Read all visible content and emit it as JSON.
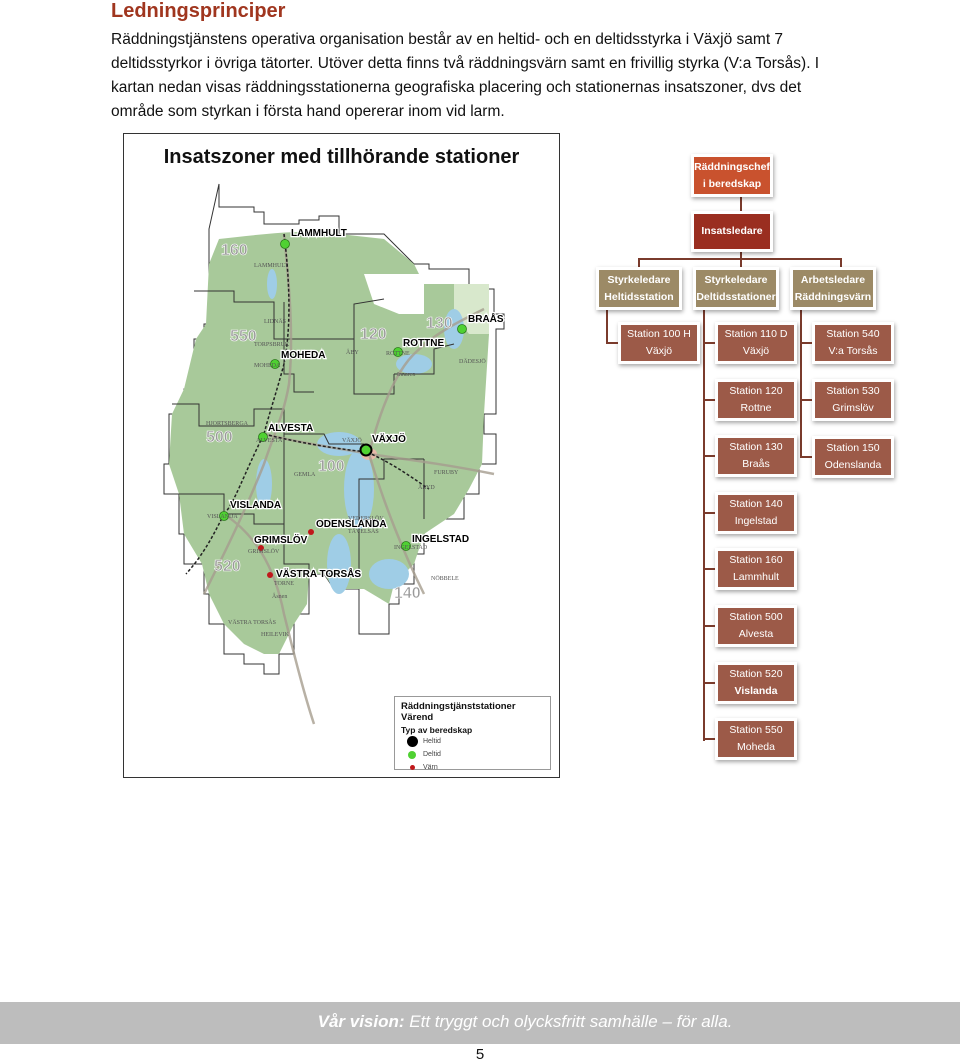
{
  "section": {
    "heading": "Ledningsprinciper",
    "paragraph": "Räddningstjänstens operativa organisation består av en heltid- och en deltidsstyrka i Växjö samt 7 deltidsstyrkor i övriga tätorter. Utöver detta finns två räddningsvärn samt en frivillig styrka (V:a Torsås). I kartan nedan visas räddningsstationerna geografiska placering och stationernas insatszoner, dvs det område som styrkan i första hand opererar inom vid larm."
  },
  "map": {
    "title": "Insatszoner med tillhörande stationer",
    "zone_numbers": [
      "160",
      "550",
      "120",
      "130",
      "500",
      "100",
      "520",
      "140"
    ],
    "station_labels": [
      "LAMMHULT",
      "BRAÅS",
      "MOHEDA",
      "ROTTNE",
      "ALVESTA",
      "VÄXJÖ",
      "VISLANDA",
      "ODENSLANDA",
      "GRIMSLÖV",
      "INGELSTAD",
      "VÄSTRA TORSÅS"
    ],
    "place_names": [
      "LAMMHULT",
      "LIDNÄS",
      "TORPSBRUK",
      "MOHEDA",
      "ÅBY",
      "ROTTNE",
      "DÄDESJÖ",
      "Innaren",
      "HJORTSBERGA",
      "ALVESTA",
      "VÄXJÖ",
      "GEMLA",
      "FURUBY",
      "ÅRYD",
      "VISLANDA",
      "VEDERSLÖV",
      "TÄVELSÅS",
      "GRIMSLÖV",
      "INGELSTAD",
      "TORNE",
      "Åsnen",
      "NÖBBELE",
      "VÄSTRA TORSÅS",
      "HEILEVIK"
    ],
    "legend": {
      "title": "Räddningstjänststationer Värend",
      "subtitle": "Typ av beredskap",
      "items": [
        {
          "label": "Heltid",
          "color": "#000000"
        },
        {
          "label": "Deltid",
          "color": "#4fd132"
        },
        {
          "label": "Värn",
          "color": "#c0181b"
        }
      ]
    }
  },
  "org_chart": {
    "chief": "Räddningschef i beredskap",
    "incident_commander": "Insatsledare",
    "leaders": [
      {
        "line1": "Styrkeledare",
        "line2": "Heltidsstation"
      },
      {
        "line1": "Styrkeledare",
        "line2": "Deltidsstationer"
      },
      {
        "line1": "Arbetsledare",
        "line2": "Räddningsvärn"
      }
    ],
    "fulltime_stations": [
      {
        "line1": "Station 100 H",
        "line2": "Växjö"
      }
    ],
    "parttime_stations": [
      {
        "line1": "Station 110 D",
        "line2": "Växjö"
      },
      {
        "line1": "Station 120",
        "line2": "Rottne"
      },
      {
        "line1": "Station 130",
        "line2": "Braås"
      },
      {
        "line1": "Station 140",
        "line2": "Ingelstad"
      },
      {
        "line1": "Station 160",
        "line2": "Lammhult"
      },
      {
        "line1": "Station 500",
        "line2": "Alvesta"
      },
      {
        "line1": "Station 520",
        "line2": "Vislanda"
      },
      {
        "line1": "Station 550",
        "line2": "Moheda"
      }
    ],
    "volunteer_stations": [
      {
        "line1": "Station 540",
        "line2": "V:a Torsås"
      },
      {
        "line1": "Station 530",
        "line2": "Grimslöv"
      },
      {
        "line1": "Station 150",
        "line2": "Odenslanda"
      }
    ]
  },
  "footer": {
    "vision_label": "Vår vision:",
    "vision_text": " Ett tryggt och olycksfritt samhälle – för alla.",
    "page_number": "5"
  }
}
